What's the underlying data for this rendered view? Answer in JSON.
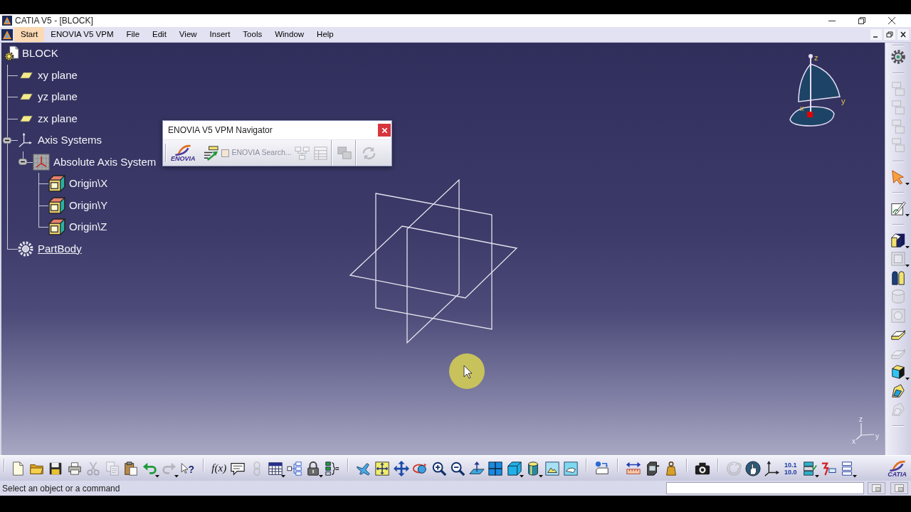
{
  "window": {
    "title": "CATIA V5 - [BLOCK]"
  },
  "menu_bar": {
    "items": [
      {
        "label": "Start",
        "selected": true
      },
      {
        "label": "ENOVIA V5 VPM",
        "selected": false
      },
      {
        "label": "File",
        "selected": false
      },
      {
        "label": "Edit",
        "selected": false
      },
      {
        "label": "View",
        "selected": false
      },
      {
        "label": "Insert",
        "selected": false
      },
      {
        "label": "Tools",
        "selected": false
      },
      {
        "label": "Window",
        "selected": false
      },
      {
        "label": "Help",
        "selected": false
      }
    ]
  },
  "specification_tree": {
    "root": {
      "label": "BLOCK",
      "kind": "part",
      "in_work": false,
      "children": [
        {
          "label": "xy plane",
          "kind": "plane",
          "in_work": false
        },
        {
          "label": "yz plane",
          "kind": "plane",
          "in_work": false
        },
        {
          "label": "zx plane",
          "kind": "plane",
          "in_work": false
        },
        {
          "label": "Axis Systems",
          "kind": "axis-systems",
          "in_work": false,
          "expanded": true,
          "children": [
            {
              "label": "Absolute Axis System",
              "kind": "axis-system",
              "in_work": false,
              "expanded": true,
              "children": [
                {
                  "label": "Origin\\X",
                  "kind": "origin",
                  "in_work": false
                },
                {
                  "label": "Origin\\Y",
                  "kind": "origin",
                  "in_work": false
                },
                {
                  "label": "Origin\\Z",
                  "kind": "origin",
                  "in_work": false
                }
              ]
            }
          ]
        },
        {
          "label": "PartBody",
          "kind": "body",
          "in_work": true
        }
      ]
    }
  },
  "navigator": {
    "title": "ENOVIA V5 VPM Navigator",
    "logo_text": "ENOVIA",
    "tools": [
      {
        "kind": "open-arrow",
        "disabled": false
      },
      {
        "kind": "search-checkbox",
        "label": "ENOVIA Search...",
        "checked": false,
        "disabled": true
      },
      {
        "kind": "tree-boxes",
        "disabled": true
      },
      {
        "kind": "grid-window",
        "disabled": true
      },
      {
        "kind": "separator"
      },
      {
        "kind": "overlapping-windows",
        "disabled": true
      },
      {
        "kind": "separator"
      },
      {
        "kind": "refresh-arrows",
        "disabled": true
      }
    ]
  },
  "compass": {
    "labels": {
      "z": "z",
      "y": "y",
      "x": "x"
    }
  },
  "right_toolbar": [
    {
      "kind": "separator"
    },
    {
      "kind": "gear",
      "disabled": false,
      "dropdown": false
    },
    {
      "kind": "separator"
    },
    {
      "kind": "stacked-boxes",
      "disabled": true,
      "dropdown": false
    },
    {
      "kind": "stacked-boxes",
      "disabled": true,
      "dropdown": false
    },
    {
      "kind": "stacked-boxes",
      "disabled": true,
      "dropdown": false
    },
    {
      "kind": "stacked-boxes",
      "disabled": true,
      "dropdown": false
    },
    {
      "kind": "separator"
    },
    {
      "kind": "pointer-arrow",
      "disabled": false,
      "dropdown": true
    },
    {
      "kind": "separator"
    },
    {
      "kind": "sketch-pencil",
      "disabled": false,
      "dropdown": true
    },
    {
      "kind": "separator"
    },
    {
      "kind": "extruded-block",
      "disabled": false,
      "dropdown": true
    },
    {
      "kind": "recessed-block",
      "disabled": true,
      "dropdown": true
    },
    {
      "kind": "split-cylinder",
      "disabled": false,
      "dropdown": false
    },
    {
      "kind": "ring-block",
      "disabled": true,
      "dropdown": false
    },
    {
      "kind": "hole-block",
      "disabled": true,
      "dropdown": false
    },
    {
      "kind": "swept-block",
      "disabled": false,
      "dropdown": false
    },
    {
      "kind": "slanted-block",
      "disabled": true,
      "dropdown": false
    },
    {
      "kind": "shaded-cube",
      "disabled": false,
      "dropdown": true
    },
    {
      "kind": "ribbon",
      "disabled": false,
      "dropdown": false
    },
    {
      "kind": "folded-block",
      "disabled": true,
      "dropdown": false
    },
    {
      "kind": "separator"
    }
  ],
  "mini_axis": {
    "labels": {
      "z": "z",
      "y": "y",
      "x": "x"
    }
  },
  "bottom_toolbar": [
    {
      "kind": "page",
      "disabled": false,
      "dropdown": false
    },
    {
      "kind": "folder",
      "disabled": false,
      "dropdown": false
    },
    {
      "kind": "floppy-disk",
      "disabled": false,
      "dropdown": false
    },
    {
      "kind": "printer",
      "disabled": false,
      "dropdown": false
    },
    {
      "kind": "scissors",
      "disabled": true,
      "dropdown": false
    },
    {
      "kind": "copy",
      "disabled": true,
      "dropdown": false
    },
    {
      "kind": "clipboard",
      "disabled": false,
      "dropdown": false
    },
    {
      "kind": "undo-arrow",
      "disabled": false,
      "dropdown": true
    },
    {
      "kind": "redo-arrow",
      "disabled": true,
      "dropdown": true
    },
    {
      "kind": "help",
      "glyph": "?",
      "disabled": false,
      "dropdown": false
    },
    {
      "kind": "separator"
    },
    {
      "kind": "formula",
      "glyph": "f(x)",
      "disabled": false,
      "dropdown": false
    },
    {
      "kind": "speech-bubble",
      "disabled": false,
      "dropdown": false
    },
    {
      "kind": "chain-link",
      "disabled": true,
      "dropdown": false
    },
    {
      "kind": "table-grid",
      "disabled": false,
      "dropdown": true
    },
    {
      "kind": "tree-diagram",
      "disabled": false,
      "dropdown": false
    },
    {
      "kind": "padlock",
      "disabled": false,
      "dropdown": true
    },
    {
      "kind": "bracket-list",
      "disabled": false,
      "dropdown": false
    },
    {
      "kind": "separator"
    },
    {
      "kind": "airplane",
      "disabled": false,
      "dropdown": false
    },
    {
      "kind": "fit-frame",
      "disabled": false,
      "dropdown": false
    },
    {
      "kind": "pan-arrows",
      "disabled": false,
      "dropdown": false
    },
    {
      "kind": "rotate",
      "disabled": false,
      "dropdown": false
    },
    {
      "kind": "zoom-in",
      "disabled": false,
      "dropdown": false
    },
    {
      "kind": "zoom-out",
      "disabled": false,
      "dropdown": false
    },
    {
      "kind": "plane-arrow",
      "disabled": false,
      "dropdown": false
    },
    {
      "kind": "four-panes",
      "disabled": false,
      "dropdown": false
    },
    {
      "kind": "cube",
      "disabled": false,
      "dropdown": true
    },
    {
      "kind": "cylinder",
      "disabled": false,
      "dropdown": true
    },
    {
      "kind": "picture",
      "disabled": false,
      "dropdown": false
    },
    {
      "kind": "picture-swap",
      "disabled": false,
      "dropdown": false
    },
    {
      "kind": "separator"
    },
    {
      "kind": "catalog-boxes",
      "disabled": false,
      "dropdown": false
    },
    {
      "kind": "separator"
    },
    {
      "kind": "ruler-arrows",
      "disabled": false,
      "dropdown": false
    },
    {
      "kind": "measure-block",
      "disabled": false,
      "dropdown": false
    },
    {
      "kind": "weight",
      "disabled": false,
      "dropdown": false
    },
    {
      "kind": "separator"
    },
    {
      "kind": "camera",
      "disabled": false,
      "dropdown": false
    },
    {
      "kind": "separator"
    },
    {
      "kind": "spiral",
      "disabled": true,
      "dropdown": false
    },
    {
      "kind": "hand-globe",
      "disabled": false,
      "dropdown": false
    },
    {
      "kind": "axis",
      "disabled": false,
      "dropdown": false
    },
    {
      "kind": "units",
      "lines": [
        "10.1",
        "10.0"
      ],
      "disabled": false,
      "dropdown": false
    },
    {
      "kind": "layers",
      "disabled": false,
      "dropdown": true
    },
    {
      "kind": "lightning",
      "disabled": false,
      "dropdown": false
    },
    {
      "kind": "list-bars",
      "disabled": false,
      "dropdown": true
    }
  ],
  "brand": {
    "logo_text": "CATIA"
  },
  "status_bar": {
    "message": "Select an object or a command"
  }
}
